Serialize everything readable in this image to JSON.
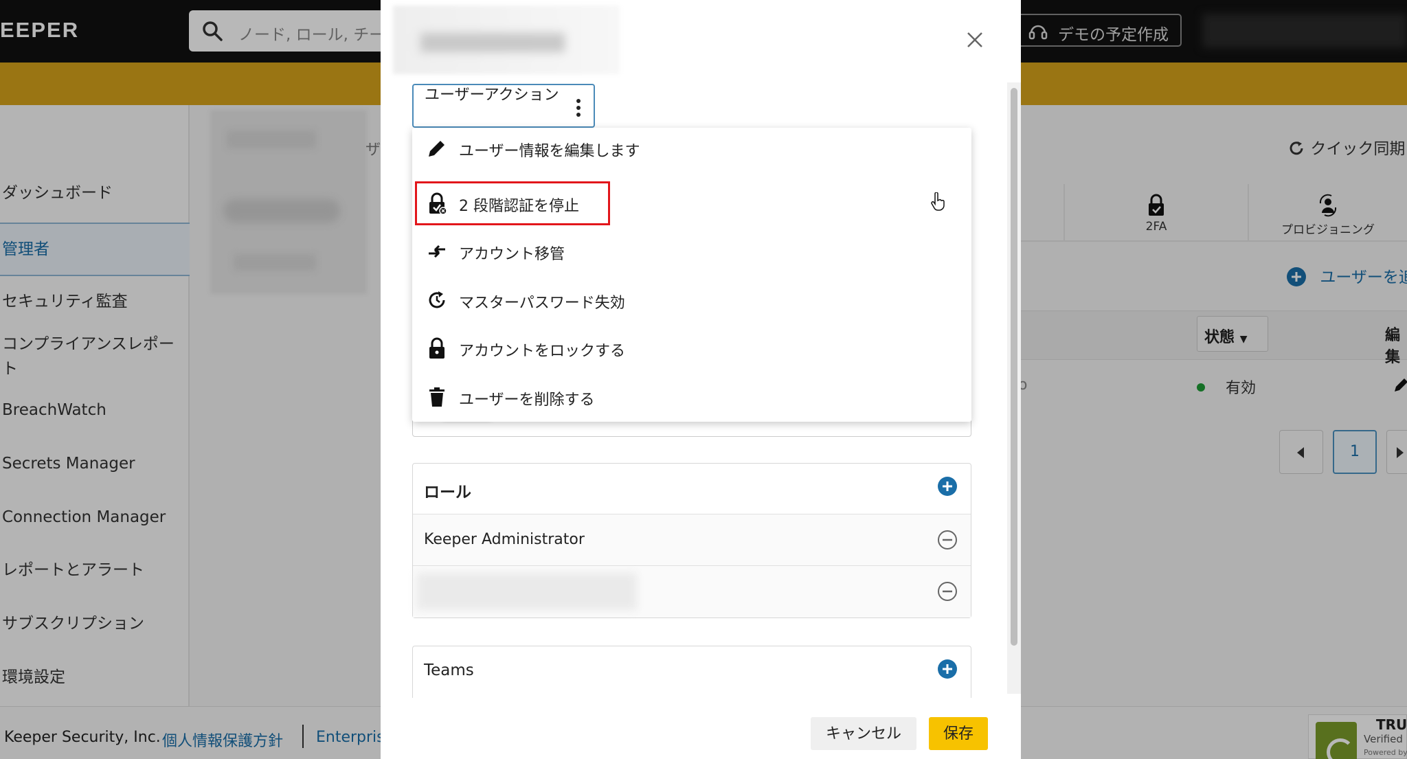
{
  "app": {
    "logo": "EEPER",
    "search_placeholder": "ノード, ロール, チー",
    "demo_button": "デモの予定作成"
  },
  "sidebar": {
    "items": [
      {
        "label": "ダッシュボード"
      },
      {
        "label": "管理者",
        "active": true
      },
      {
        "label": "セキュリティ監査"
      },
      {
        "label": "コンプライアンスレポート"
      },
      {
        "label": "BreachWatch"
      },
      {
        "label": "Secrets Manager"
      },
      {
        "label": "Connection Manager"
      },
      {
        "label": "レポートとアラート"
      },
      {
        "label": "サブスクリプション"
      },
      {
        "label": "環境設定"
      }
    ]
  },
  "main": {
    "fragment": "ザ",
    "quick_sync": "クイック同期",
    "tabs": [
      {
        "label": "2FA",
        "icon": "lock-check-icon"
      },
      {
        "label": "プロビジョニング",
        "icon": "provisioning-icon"
      }
    ],
    "add_user": "ユーザーを追",
    "table": {
      "status_header": "状態",
      "edit_header": "編集",
      "row_fragment": "o",
      "row_status": "有効"
    },
    "pager_current": "1"
  },
  "footer": {
    "company": "Keeper Security, Inc.",
    "privacy_link": "個人情報保護方針",
    "enterprise_link": "Enterpris",
    "trust_title": "TRU",
    "trust_verified": "Verified I",
    "trust_powered": "Powered by"
  },
  "modal": {
    "action_button": "ユーザーアクション",
    "dropdown": [
      {
        "label": "ユーザー情報を編集します",
        "icon": "pencil-icon"
      },
      {
        "label": "2 段階認証を停止",
        "icon": "lock-x-icon",
        "highlighted": true
      },
      {
        "label": "アカウント移管",
        "icon": "transfer-icon"
      },
      {
        "label": "マスターパスワード失効",
        "icon": "expire-icon"
      },
      {
        "label": "アカウントをロックする",
        "icon": "lock-icon"
      },
      {
        "label": "ユーザーを削除する",
        "icon": "trash-icon"
      }
    ],
    "roles": {
      "title": "ロール",
      "items": [
        {
          "label": "Keeper Administrator"
        }
      ]
    },
    "teams": {
      "title": "Teams"
    },
    "cancel": "キャンセル",
    "save": "保存"
  },
  "colors": {
    "banner": "#d6a21b",
    "accent_blue": "#1a6ea8",
    "save_yellow": "#f7c200",
    "highlight_red": "#e2161b",
    "status_green": "#1e9c35"
  }
}
